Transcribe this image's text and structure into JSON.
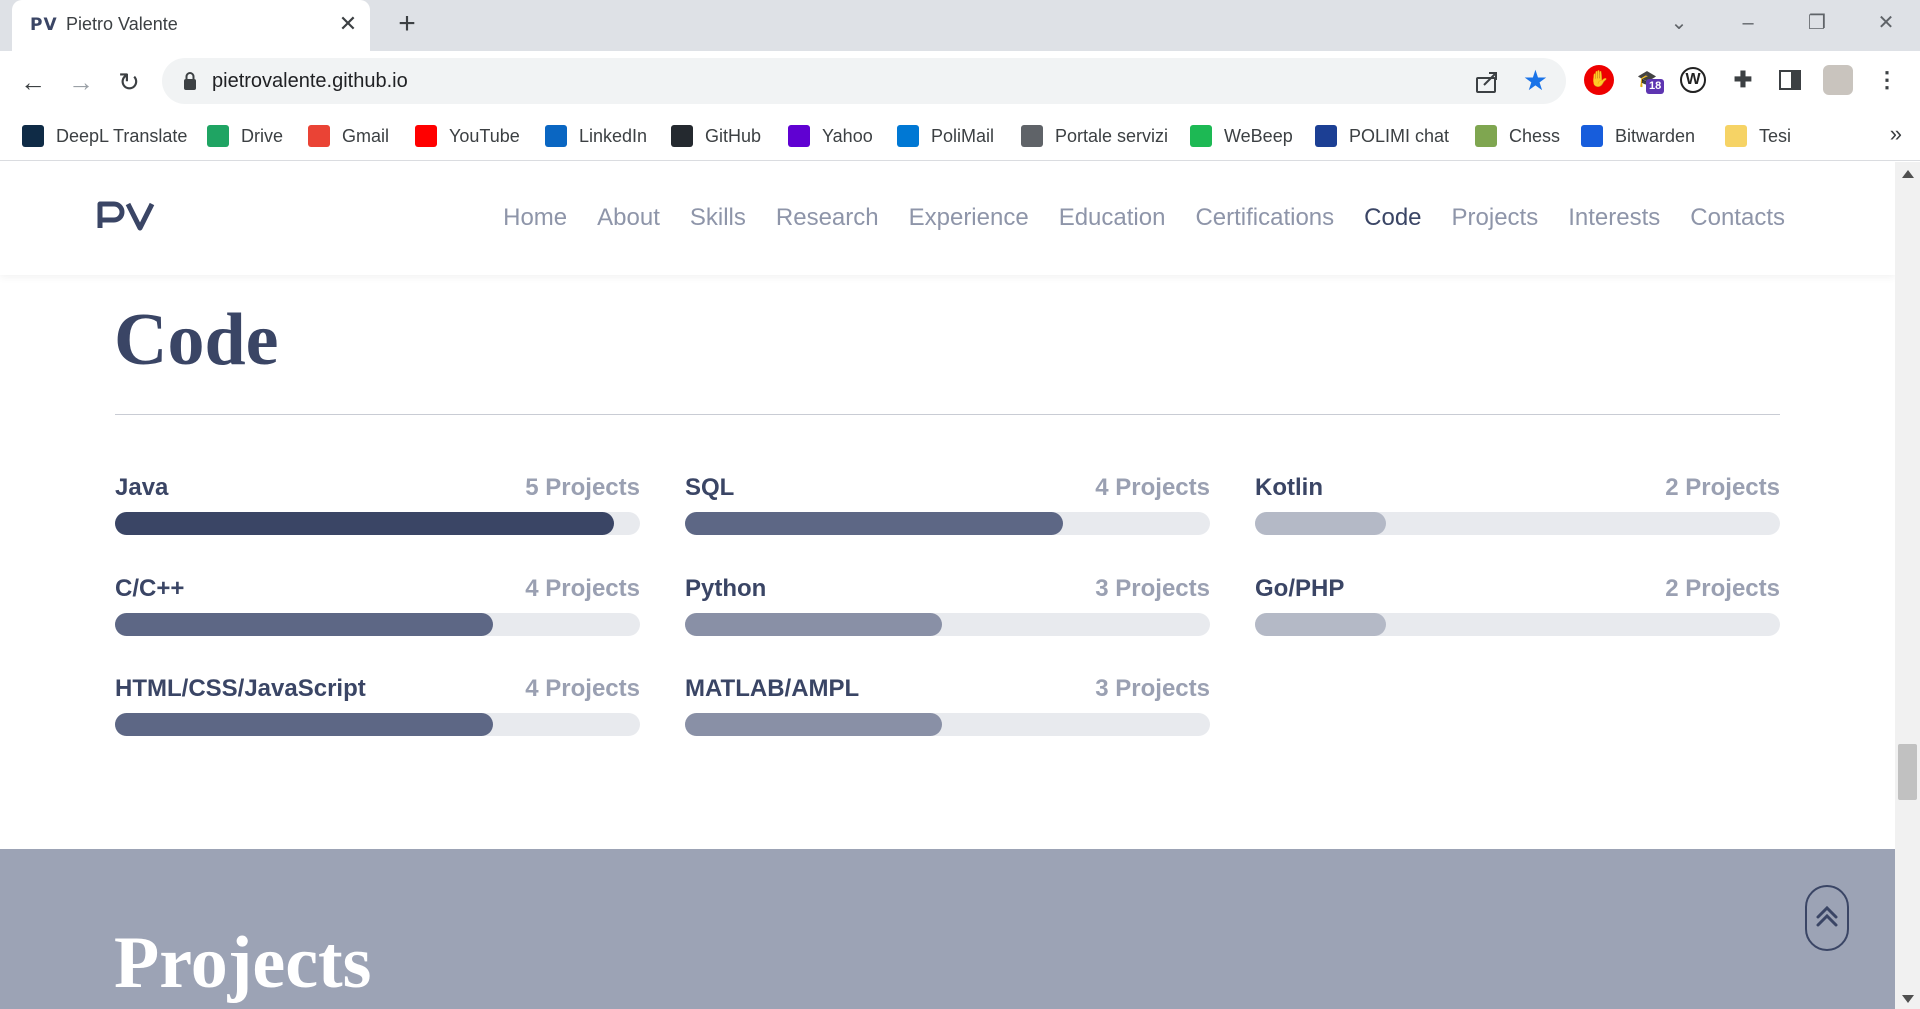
{
  "browser": {
    "tab": {
      "favicon": "PV",
      "title": "Pietro Valente",
      "close": "✕"
    },
    "new_tab": "+",
    "url": "pietrovalente.github.io",
    "bookmarks": [
      {
        "label": "DeepL Translate",
        "icon": "deepl-icon",
        "color": "#0f2b46"
      },
      {
        "label": "Drive",
        "icon": "drive-icon",
        "color": "#1fa463"
      },
      {
        "label": "Gmail",
        "icon": "gmail-icon",
        "color": "#ea4335"
      },
      {
        "label": "YouTube",
        "icon": "youtube-icon",
        "color": "#ff0000"
      },
      {
        "label": "LinkedIn",
        "icon": "linkedin-icon",
        "color": "#0a66c2"
      },
      {
        "label": "GitHub",
        "icon": "github-icon",
        "color": "#24292f"
      },
      {
        "label": "Yahoo",
        "icon": "yahoo-icon",
        "color": "#6001d2"
      },
      {
        "label": "PoliMail",
        "icon": "outlook-icon",
        "color": "#0078d4"
      },
      {
        "label": "Portale servizi",
        "icon": "globe-icon",
        "color": "#5f6368"
      },
      {
        "label": "WeBeep",
        "icon": "webeep-icon",
        "color": "#1db954"
      },
      {
        "label": "POLIMI chat",
        "icon": "polimi-icon",
        "color": "#1c3f94"
      },
      {
        "label": "Chess",
        "icon": "chess-icon",
        "color": "#7fa650"
      },
      {
        "label": "Bitwarden",
        "icon": "bitwarden-icon",
        "color": "#175ddc"
      },
      {
        "label": "Tesi",
        "icon": "folder-icon",
        "color": "#f6d365"
      }
    ],
    "bookmarks_more": "»",
    "extensions": [
      {
        "name": "adblock-icon",
        "badge": ""
      },
      {
        "name": "graduation-cap-icon",
        "badge": "18"
      },
      {
        "name": "wordpress-icon",
        "badge": ""
      }
    ]
  },
  "site": {
    "logo": "PV",
    "nav": [
      "Home",
      "About",
      "Skills",
      "Research",
      "Experience",
      "Education",
      "Certifications",
      "Code",
      "Projects",
      "Interests",
      "Contacts"
    ],
    "active_nav": "Code",
    "code_section": {
      "title": "Code",
      "skills": [
        {
          "name": "Java",
          "count": "5 Projects",
          "level": 0.95,
          "color": "#3a4565"
        },
        {
          "name": "SQL",
          "count": "4 Projects",
          "level": 0.72,
          "color": "#5d6785"
        },
        {
          "name": "Kotlin",
          "count": "2 Projects",
          "level": 0.25,
          "color": "#b4b9c6"
        },
        {
          "name": "C/C++",
          "count": "4 Projects",
          "level": 0.72,
          "color": "#5d6785"
        },
        {
          "name": "Python",
          "count": "3 Projects",
          "level": 0.49,
          "color": "#8990a6"
        },
        {
          "name": "Go/PHP",
          "count": "2 Projects",
          "level": 0.25,
          "color": "#b4b9c6"
        },
        {
          "name": "HTML/CSS/JavaScript",
          "count": "4 Projects",
          "level": 0.72,
          "color": "#5d6785"
        },
        {
          "name": "MATLAB/AMPL",
          "count": "3 Projects",
          "level": 0.49,
          "color": "#8990a6"
        }
      ]
    },
    "projects_section": {
      "title": "Projects"
    }
  }
}
